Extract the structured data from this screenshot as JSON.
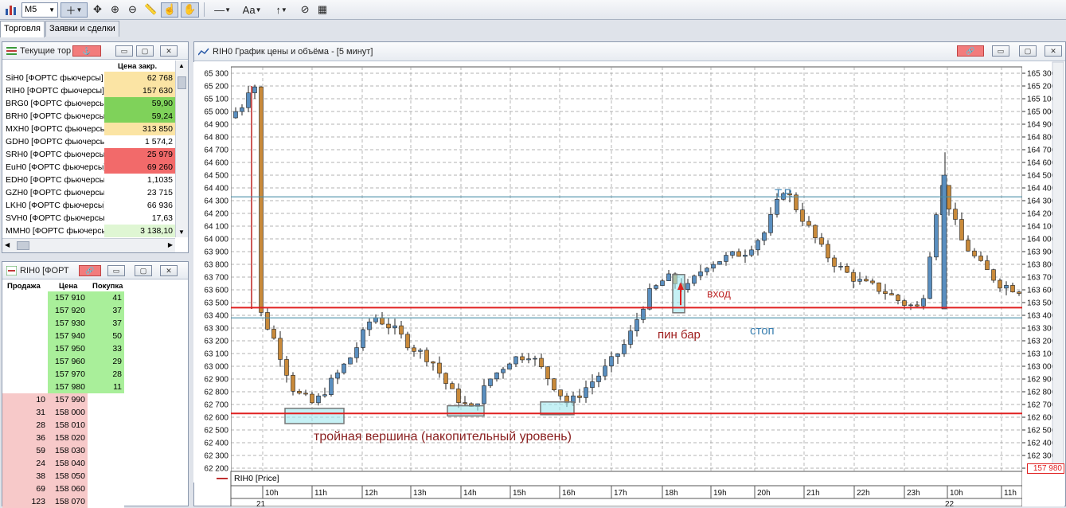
{
  "toolbar": {
    "interval": "M5",
    "text_tool": "Аа",
    "icons": [
      "bar-chart-icon",
      "crosshair-icon",
      "move-icon",
      "zoom-in-icon",
      "zoom-out-icon",
      "ruler-icon",
      "hand-select-icon",
      "hand-move-icon",
      "line-tool-icon",
      "text-tool-icon",
      "arrow-tool-icon",
      "eye-off-icon",
      "grid-icon"
    ]
  },
  "tabs": [
    "Торговля",
    "Заявки и сделки"
  ],
  "quotes": {
    "title": "Текущие тор",
    "column_price": "Цена закр.",
    "rows": [
      {
        "name": "SiH0 [ФОРТС фьючерсы]",
        "value": "62 768",
        "color": "#fbe4a4"
      },
      {
        "name": "RIH0 [ФОРТС фьючерсы]",
        "value": "157 630",
        "color": "#fbe4a4"
      },
      {
        "name": "BRG0 [ФОРТС фьючерсы]",
        "value": "59,90",
        "color": "#7fd25a"
      },
      {
        "name": "BRH0 [ФОРТС фьючерсы]",
        "value": "59,24",
        "color": "#7fd25a"
      },
      {
        "name": "MXH0 [ФОРТС фьючерсы]",
        "value": "313 850",
        "color": "#fbe4a4"
      },
      {
        "name": "GDH0 [ФОРТС фьючерсы]",
        "value": "1 574,2",
        "color": "#ffffff"
      },
      {
        "name": "SRH0 [ФОРТС фьючерсы]",
        "value": "25 979",
        "color": "#f26a6a"
      },
      {
        "name": "EuH0 [ФОРТС фьючерсы]",
        "value": "69 260",
        "color": "#f26a6a"
      },
      {
        "name": "EDH0 [ФОРТС фьючерсы]",
        "value": "1,1035",
        "color": "#ffffff"
      },
      {
        "name": "GZH0 [ФОРТС фьючерсы]",
        "value": "23 715",
        "color": "#ffffff"
      },
      {
        "name": "LKH0 [ФОРТС фьючерсы]",
        "value": "66 936",
        "color": "#ffffff"
      },
      {
        "name": "SVH0 [ФОРТС фьючерсы]",
        "value": "17,63",
        "color": "#ffffff"
      },
      {
        "name": "MMH0 [ФОРТС фьючерсы]",
        "value": "3 138,10",
        "color": "#dff6d3"
      }
    ]
  },
  "orderbook": {
    "title": "RIH0 [ФОРТ",
    "headers": [
      "Продажа",
      "Цена",
      "Покупка"
    ],
    "bids": [
      {
        "price": "157 910",
        "qty": "41"
      },
      {
        "price": "157 920",
        "qty": "37"
      },
      {
        "price": "157 930",
        "qty": "37"
      },
      {
        "price": "157 940",
        "qty": "50"
      },
      {
        "price": "157 950",
        "qty": "33"
      },
      {
        "price": "157 960",
        "qty": "29"
      },
      {
        "price": "157 970",
        "qty": "28"
      },
      {
        "price": "157 980",
        "qty": "11"
      }
    ],
    "asks": [
      {
        "qty": "10",
        "price": "157 990"
      },
      {
        "qty": "31",
        "price": "158 000"
      },
      {
        "qty": "28",
        "price": "158 010"
      },
      {
        "qty": "36",
        "price": "158 020"
      },
      {
        "qty": "59",
        "price": "158 030"
      },
      {
        "qty": "24",
        "price": "158 040"
      },
      {
        "qty": "38",
        "price": "158 050"
      },
      {
        "qty": "69",
        "price": "158 060"
      },
      {
        "qty": "123",
        "price": "158 070"
      }
    ]
  },
  "chart": {
    "window_title": "RIH0 График цены и объёма - [5 минут]",
    "legend": "RIH0 [Price]",
    "price_marker": "157 980",
    "date_left": "21",
    "date_right": "22",
    "annotations": {
      "tp": "Т.Р.",
      "entry": "вход",
      "pin_bar": "пин бар",
      "stop": "стоп",
      "triple_top": "тройная вершина (накопительный уровень)"
    },
    "colors": {
      "up": "#5a8fc0",
      "down": "#c98a3a",
      "red_line": "#e02020",
      "blue_line": "#4a8fa8",
      "highlight": "#9ee8ef"
    }
  },
  "chart_data": {
    "type": "candlestick",
    "title": "RIH0 График цены и объёма - [5 минут]",
    "left_axis": {
      "min": 62200,
      "max": 65300,
      "step": 100
    },
    "right_axis": {
      "min": 162200,
      "max": 165300,
      "step": 100
    },
    "x_ticks": [
      "10h",
      "11h",
      "12h",
      "13h",
      "14h",
      "15h",
      "16h",
      "17h",
      "18h",
      "19h",
      "20h",
      "21h",
      "22h",
      "23h",
      "10h",
      "11h"
    ],
    "levels": [
      {
        "name": "accumulation_level",
        "value": 62630,
        "color": "red"
      },
      {
        "name": "entry",
        "value": 63460,
        "color": "red"
      },
      {
        "name": "stop",
        "value": 63380,
        "color": "blue"
      },
      {
        "name": "take_profit",
        "value": 64330,
        "color": "blue"
      }
    ],
    "approx_closes": [
      65180,
      63500,
      63200,
      62800,
      62700,
      62900,
      63100,
      63400,
      63300,
      63150,
      63050,
      62800,
      62650,
      62900,
      63050,
      63100,
      62900,
      62700,
      62850,
      63000,
      63200,
      63550,
      63700,
      63600,
      63800,
      63850,
      63900,
      64050,
      64400,
      64150,
      63900,
      63750,
      63650,
      63600,
      63500,
      63450,
      64450,
      64000,
      63800,
      63650,
      63600
    ]
  }
}
